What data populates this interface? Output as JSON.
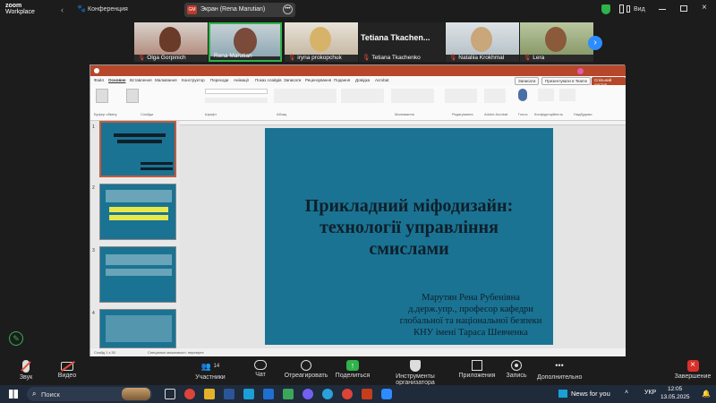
{
  "zoom": {
    "logo_line1": "zoom",
    "logo_line2": "Workplace",
    "conference_label": "Конференция",
    "share_badge": "GM",
    "share_title": "Экран (Rena Marutian)",
    "view_label": "Вид"
  },
  "participants": [
    {
      "name": "Olga Gorpinich"
    },
    {
      "name": "Rena Marutian"
    },
    {
      "name": "iryna prokopchuk"
    },
    {
      "name": "Tetiana Tkachenko",
      "big_name": "Tetiana  Tkachen..."
    },
    {
      "name": "Nataliia Krokhmal"
    },
    {
      "name": "Lera"
    }
  ],
  "powerpoint": {
    "menu_tabs": [
      "Файл",
      "Основне",
      "Вставлення",
      "Малювання",
      "Конструктор",
      "Переходи",
      "Анімації",
      "Показ слайдів",
      "Записати",
      "Рецензування",
      "Подання",
      "Довідка",
      "Acrobat"
    ],
    "record_button": "Записати",
    "present_button": "Презентувати в Teams",
    "share_button": "Спільний доступ",
    "ribbon_groups": [
      "Буфер обміну",
      "Слайди",
      "Шрифт",
      "Абзац",
      "Малювання",
      "Редагування",
      "Adobe Acrobat",
      "Голос",
      "Конфіденційність",
      "Надбудови"
    ],
    "slide_numbers": [
      "1",
      "2",
      "3",
      "4"
    ],
    "status_left": "Слайд 1 з 30",
    "status_mid": "Спеціальні можливості: перевірте",
    "slide": {
      "title": "Прикладний міфодизайн: технології управління смислами",
      "author_lines": [
        "Марутян Рена Рубенівна",
        "д.держ.упр., професор кафедри",
        "глобальної та національної безпеки",
        "КНУ імені Тараса Шевченка"
      ]
    }
  },
  "toolbar": {
    "items": [
      {
        "label": "Звук"
      },
      {
        "label": "Видео"
      },
      {
        "label": "Участники",
        "count": "14"
      },
      {
        "label": "Чат"
      },
      {
        "label": "Отреагировать"
      },
      {
        "label": "Поделиться"
      },
      {
        "label": "Инструменты организатора"
      },
      {
        "label": "Приложения"
      },
      {
        "label": "Запись"
      },
      {
        "label": "Дополнительно"
      },
      {
        "label": "Завершение"
      }
    ]
  },
  "taskbar": {
    "search_placeholder": "Поиск",
    "news_label": "News for you",
    "language": "УКР",
    "time": "12:05",
    "date": "13.05.2025"
  },
  "colors": {
    "slide_bg": "#1a7393",
    "ppt_accent": "#b7472a",
    "end_button": "#d9302b",
    "share_green": "#2fb34a"
  }
}
